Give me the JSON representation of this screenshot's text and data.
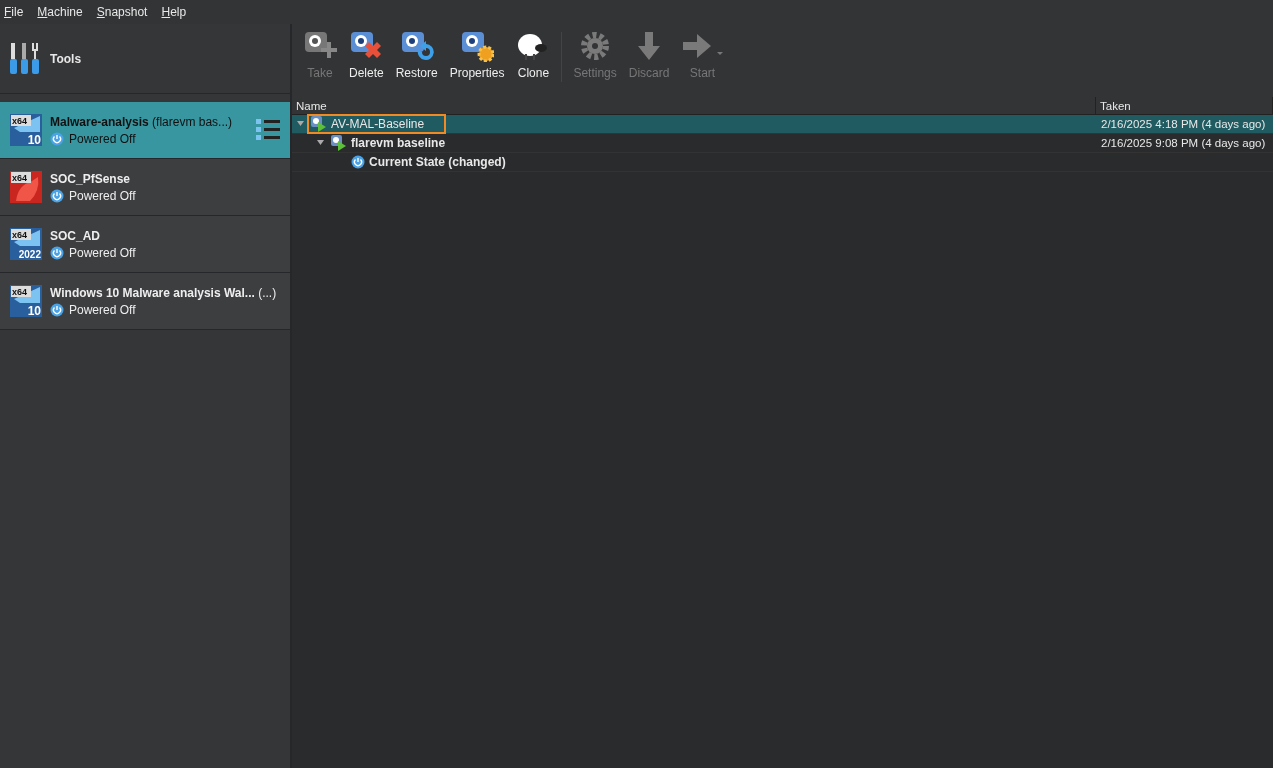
{
  "menu": [
    "File",
    "Machine",
    "Snapshot",
    "Help"
  ],
  "tools": {
    "label": "Tools"
  },
  "machines": [
    {
      "title": "**Malware-analysis** (flarevm bas...)",
      "os_badge": "x64",
      "version": "10",
      "kind": "windows",
      "status": "Powered Off",
      "selected": true
    },
    {
      "title": "**SOC_PfSense**",
      "os_badge": "x64",
      "kind": "bsd",
      "status": "Powered Off",
      "selected": false
    },
    {
      "title": "**SOC_AD**",
      "os_badge": "x64",
      "version": "2022",
      "kind": "windows",
      "status": "Powered Off",
      "selected": false
    },
    {
      "title": "**Windows 10 Malware analysis Wal...** (...)",
      "os_badge": "x64",
      "version": "10",
      "kind": "windows",
      "status": "Powered Off",
      "selected": false
    }
  ],
  "toolbar": [
    {
      "label": "Take",
      "kind": "take",
      "disabled": true
    },
    {
      "label": "Delete",
      "kind": "delete",
      "disabled": false
    },
    {
      "label": "Restore",
      "kind": "restore",
      "disabled": false
    },
    {
      "label": "Properties",
      "kind": "properties",
      "disabled": false
    },
    {
      "label": "Clone",
      "kind": "clone",
      "disabled": false
    },
    {
      "kind": "separator"
    },
    {
      "label": "Settings",
      "kind": "settings",
      "disabled": true
    },
    {
      "label": "Discard",
      "kind": "discard",
      "disabled": true
    },
    {
      "label": "Start",
      "kind": "start",
      "disabled": true
    }
  ],
  "table": {
    "columns": [
      "Name",
      "Taken"
    ],
    "rows": [
      {
        "name": "AV-MAL-Baseline",
        "kind": "snapshot",
        "taken": "2/16/2025 4:18 PM (4 days ago)",
        "selected": true,
        "expanded": true,
        "children": [
          {
            "name": "flarevm baseline",
            "kind": "snapshot",
            "taken": "2/16/2025 9:08 PM (4 days ago)",
            "selected": false,
            "expanded": true,
            "children": [
              {
                "name": "Current State (changed)",
                "kind": "state",
                "selected": false
              }
            ]
          }
        ]
      }
    ]
  }
}
